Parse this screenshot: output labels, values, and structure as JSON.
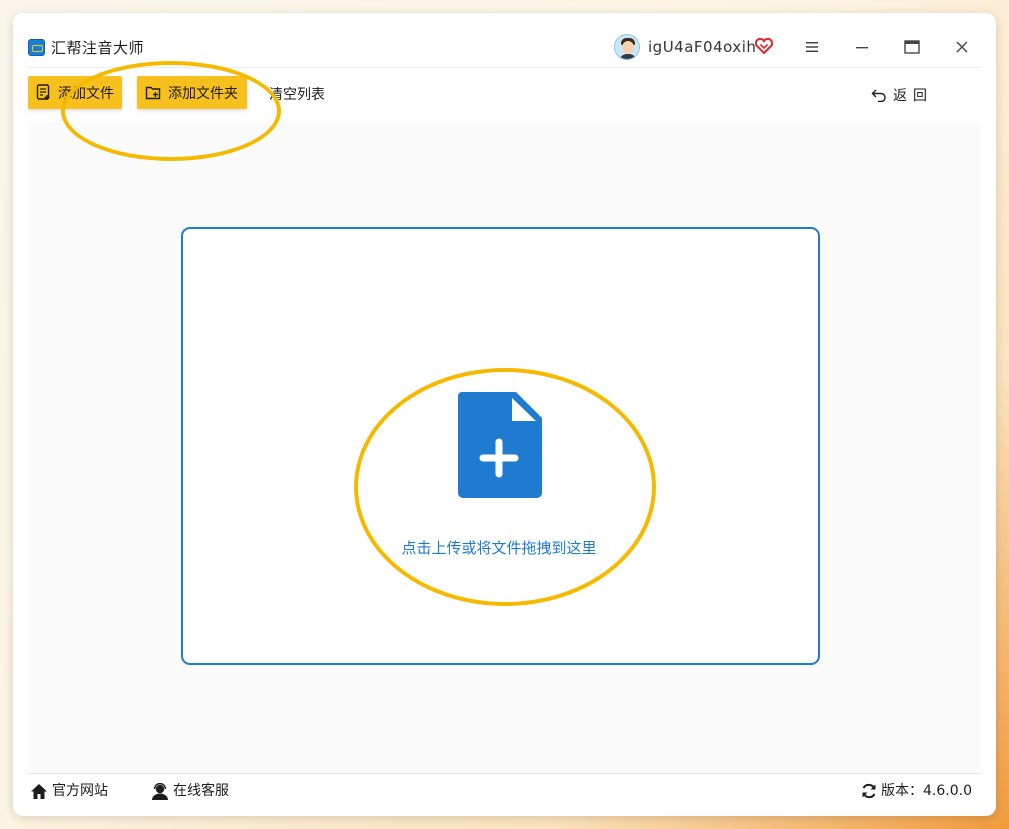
{
  "app": {
    "title": "汇帮注音大师",
    "user_name": "igU4aF04oxih"
  },
  "toolbar": {
    "add_file_label": "添加文件",
    "add_folder_label": "添加文件夹",
    "clear_list_label": "清空列表",
    "back_label": "返回"
  },
  "dropzone": {
    "hint": "点击上传或将文件拖拽到这里"
  },
  "footer": {
    "official_site_label": "官方网站",
    "support_label": "在线客服",
    "version_label": "版本：4.6.0.0"
  },
  "icons": {
    "app_logo": "app-logo-icon",
    "vip": "vip-heart-icon",
    "menu": "hamburger-menu-icon",
    "minimize": "minimize-icon",
    "maximize": "maximize-icon",
    "close": "close-icon",
    "add_file": "add-file-icon",
    "add_folder": "add-folder-icon",
    "back": "back-arrow-icon",
    "upload": "file-plus-icon",
    "home": "home-icon",
    "support": "user-headset-icon",
    "refresh": "refresh-icon"
  },
  "colors": {
    "accent_yellow": "#f7c01d",
    "accent_blue": "#1f7bd0",
    "highlight_ring": "#f5b900",
    "vip_red": "#e02828"
  }
}
